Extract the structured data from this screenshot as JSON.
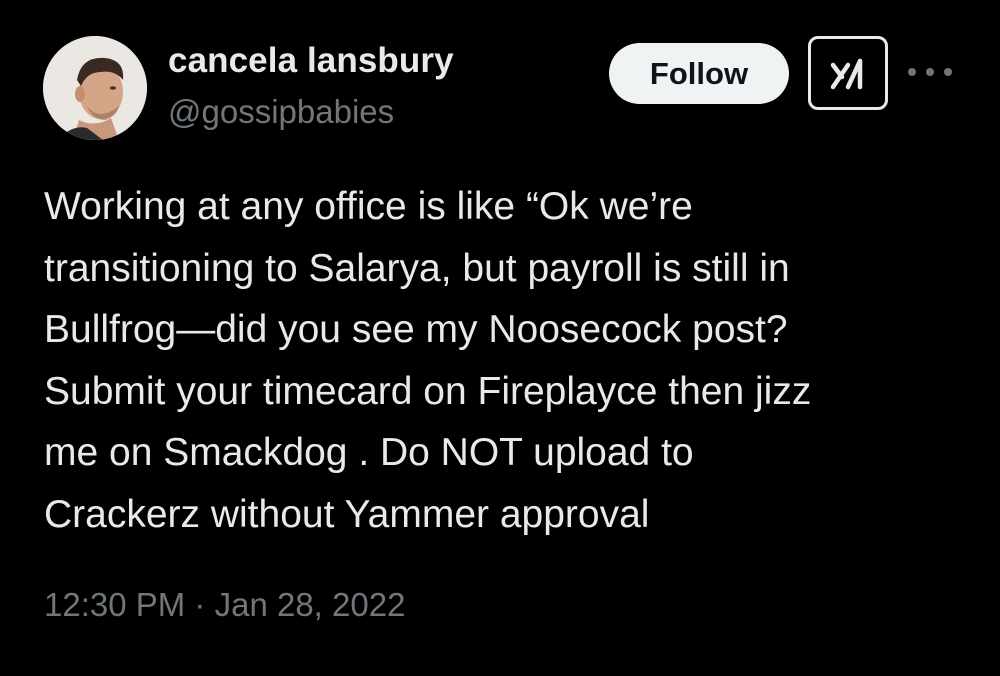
{
  "author": {
    "display_name": "cancela lansbury",
    "handle": "@gossipbabies",
    "avatar_icon": "profile-photo"
  },
  "actions": {
    "follow_label": "Follow",
    "grok_icon": "grok-icon",
    "more_icon": "more-options-icon"
  },
  "tweet": {
    "lines": [
      "Working at any office is like “Ok we’re",
      "transitioning to Salarya, but payroll is still in",
      "Bullfrog—did you see my Noosecock post?",
      "Submit your timecard on Fireplayce then jizz",
      "me on Smackdog . Do NOT upload to",
      "Crackerz without Yammer approval"
    ],
    "time": "12:30 PM",
    "separator": "·",
    "date": "Jan 28, 2022"
  },
  "colors": {
    "background": "#000000",
    "primary_text": "#e7e9ea",
    "secondary_text": "#71767b",
    "follow_button_bg": "#eff3f4",
    "follow_button_text": "#0f1419"
  }
}
